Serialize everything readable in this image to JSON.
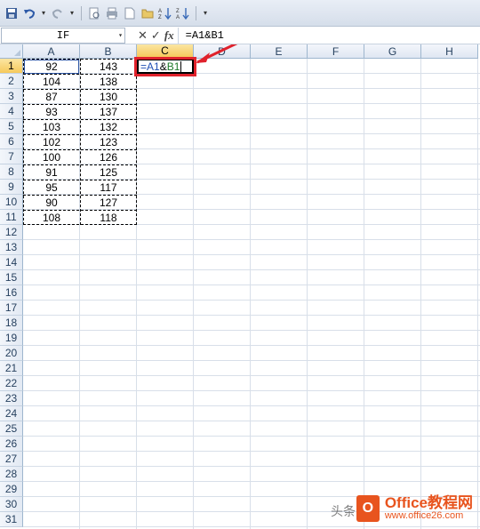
{
  "toolbar": {
    "icons": [
      "save-icon",
      "undo-icon",
      "redo-icon",
      "print-preview-icon",
      "print-icon",
      "new-document-icon",
      "open-icon",
      "sort-ascending-icon",
      "sort-descending-icon",
      "customize-toolbar-icon"
    ]
  },
  "formula_bar": {
    "name_box": "IF",
    "formula": "=A1&B1",
    "cancel_symbol": "✕",
    "confirm_symbol": "✓",
    "fx_label": "fx"
  },
  "columns": [
    "A",
    "B",
    "C",
    "D",
    "E",
    "F",
    "G",
    "H"
  ],
  "rows": [
    "1",
    "2",
    "3",
    "4",
    "5",
    "6",
    "7",
    "8",
    "9",
    "10",
    "11",
    "12",
    "13",
    "14",
    "15",
    "16",
    "17",
    "18",
    "19",
    "20",
    "21",
    "22",
    "23",
    "24",
    "25",
    "26",
    "27",
    "28",
    "29",
    "30",
    "31"
  ],
  "cells": {
    "A": [
      "92",
      "104",
      "87",
      "93",
      "103",
      "102",
      "100",
      "91",
      "95",
      "90",
      "108"
    ],
    "B": [
      "143",
      "138",
      "130",
      "137",
      "132",
      "123",
      "126",
      "125",
      "117",
      "127",
      "118"
    ]
  },
  "editing": {
    "cell": "C1",
    "ref_a": "=A1",
    "ampersand": "&",
    "ref_b": "B1"
  },
  "watermark": {
    "logo_letter": "O",
    "title": "Office教程网",
    "url": "www.office26.com",
    "side_text": "头条"
  },
  "colors": {
    "selected_header": "#f6c95c",
    "highlight": "#e0222c",
    "ref_a": "#1f4fb4",
    "ref_b": "#1e7a2a"
  }
}
